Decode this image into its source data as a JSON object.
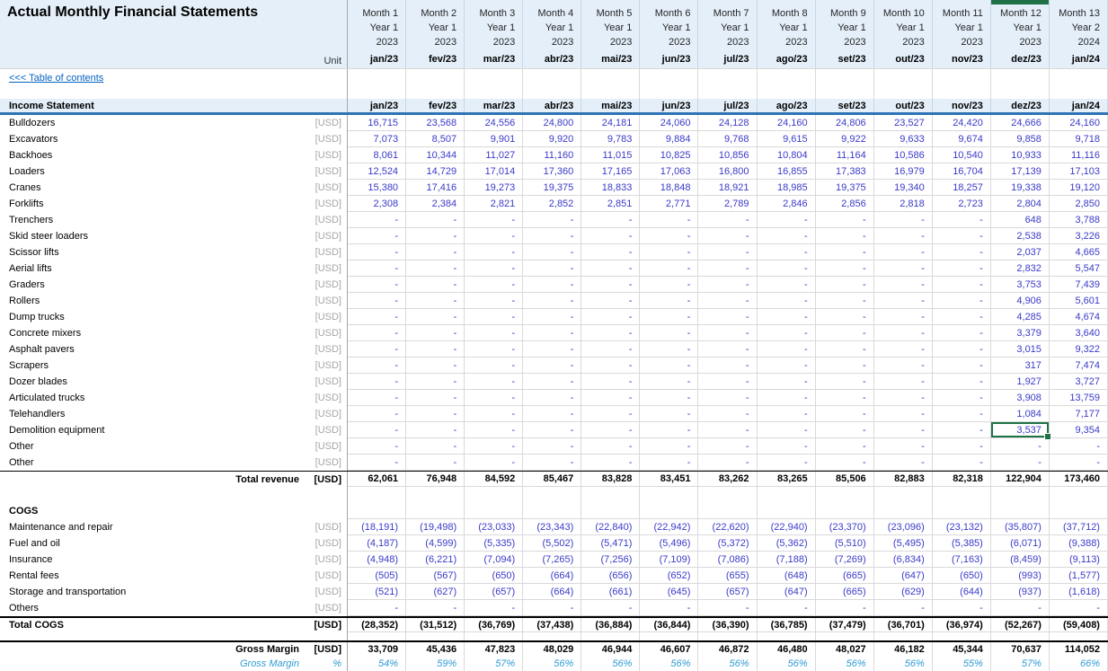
{
  "title": "Actual Monthly Financial Statements",
  "unit_header": "Unit",
  "selected_column_index": 11,
  "colors": {
    "value_blue": "#3A3AC9",
    "pct_blue": "#2E9BD4",
    "band_fill": "#E4EFF9",
    "accent_border": "#2E74B5",
    "selection_green": "#1F7246",
    "link_blue": "#0563C1",
    "unit_gray": "#A6A6A6"
  },
  "columns": [
    {
      "month": "Month 1",
      "year": "Year 1",
      "cal": "2023",
      "date": "jan/23"
    },
    {
      "month": "Month 2",
      "year": "Year 1",
      "cal": "2023",
      "date": "fev/23"
    },
    {
      "month": "Month 3",
      "year": "Year 1",
      "cal": "2023",
      "date": "mar/23"
    },
    {
      "month": "Month 4",
      "year": "Year 1",
      "cal": "2023",
      "date": "abr/23"
    },
    {
      "month": "Month 5",
      "year": "Year 1",
      "cal": "2023",
      "date": "mai/23"
    },
    {
      "month": "Month 6",
      "year": "Year 1",
      "cal": "2023",
      "date": "jun/23"
    },
    {
      "month": "Month 7",
      "year": "Year 1",
      "cal": "2023",
      "date": "jul/23"
    },
    {
      "month": "Month 8",
      "year": "Year 1",
      "cal": "2023",
      "date": "ago/23"
    },
    {
      "month": "Month 9",
      "year": "Year 1",
      "cal": "2023",
      "date": "set/23"
    },
    {
      "month": "Month 10",
      "year": "Year 1",
      "cal": "2023",
      "date": "out/23"
    },
    {
      "month": "Month 11",
      "year": "Year 1",
      "cal": "2023",
      "date": "nov/23"
    },
    {
      "month": "Month 12",
      "year": "Year 1",
      "cal": "2023",
      "date": "dez/23"
    },
    {
      "month": "Month 13",
      "year": "Year 2",
      "cal": "2024",
      "date": "jan/24"
    }
  ],
  "table_rows": [
    {
      "kind": "toc",
      "label": "<<< Table of contents",
      "h": 19
    },
    {
      "kind": "blank",
      "h": 14
    },
    {
      "kind": "band",
      "label": "Income Statement",
      "values": [
        "jan/23",
        "fev/23",
        "mar/23",
        "abr/23",
        "mai/23",
        "jun/23",
        "jul/23",
        "ago/23",
        "set/23",
        "out/23",
        "nov/23",
        "dez/23",
        "jan/24"
      ],
      "h": 18
    },
    {
      "kind": "item",
      "label": "Bulldozers",
      "unit": "[USD]",
      "values": [
        "16,715",
        "23,568",
        "24,556",
        "24,800",
        "24,181",
        "24,060",
        "24,128",
        "24,160",
        "24,806",
        "23,527",
        "24,420",
        "24,666",
        "24,160"
      ]
    },
    {
      "kind": "item",
      "label": "Excavators",
      "unit": "[USD]",
      "values": [
        "7,073",
        "8,507",
        "9,901",
        "9,920",
        "9,783",
        "9,884",
        "9,768",
        "9,615",
        "9,922",
        "9,633",
        "9,674",
        "9,858",
        "9,718"
      ]
    },
    {
      "kind": "item",
      "label": "Backhoes",
      "unit": "[USD]",
      "values": [
        "8,061",
        "10,344",
        "11,027",
        "11,160",
        "11,015",
        "10,825",
        "10,856",
        "10,804",
        "11,164",
        "10,586",
        "10,540",
        "10,933",
        "11,116"
      ]
    },
    {
      "kind": "item",
      "label": "Loaders",
      "unit": "[USD]",
      "values": [
        "12,524",
        "14,729",
        "17,014",
        "17,360",
        "17,165",
        "17,063",
        "16,800",
        "16,855",
        "17,383",
        "16,979",
        "16,704",
        "17,139",
        "17,103"
      ]
    },
    {
      "kind": "item",
      "label": "Cranes",
      "unit": "[USD]",
      "values": [
        "15,380",
        "17,416",
        "19,273",
        "19,375",
        "18,833",
        "18,848",
        "18,921",
        "18,985",
        "19,375",
        "19,340",
        "18,257",
        "19,338",
        "19,120"
      ]
    },
    {
      "kind": "item",
      "label": "Forklifts",
      "unit": "[USD]",
      "values": [
        "2,308",
        "2,384",
        "2,821",
        "2,852",
        "2,851",
        "2,771",
        "2,789",
        "2,846",
        "2,856",
        "2,818",
        "2,723",
        "2,804",
        "2,850"
      ]
    },
    {
      "kind": "item",
      "label": "Trenchers",
      "unit": "[USD]",
      "values": [
        "-",
        "-",
        "-",
        "-",
        "-",
        "-",
        "-",
        "-",
        "-",
        "-",
        "-",
        "648",
        "3,788"
      ]
    },
    {
      "kind": "item",
      "label": "Skid steer loaders",
      "unit": "[USD]",
      "values": [
        "-",
        "-",
        "-",
        "-",
        "-",
        "-",
        "-",
        "-",
        "-",
        "-",
        "-",
        "2,538",
        "3,226"
      ]
    },
    {
      "kind": "item",
      "label": "Scissor lifts",
      "unit": "[USD]",
      "values": [
        "-",
        "-",
        "-",
        "-",
        "-",
        "-",
        "-",
        "-",
        "-",
        "-",
        "-",
        "2,037",
        "4,665"
      ]
    },
    {
      "kind": "item",
      "label": "Aerial lifts",
      "unit": "[USD]",
      "values": [
        "-",
        "-",
        "-",
        "-",
        "-",
        "-",
        "-",
        "-",
        "-",
        "-",
        "-",
        "2,832",
        "5,547"
      ]
    },
    {
      "kind": "item",
      "label": "Graders",
      "unit": "[USD]",
      "values": [
        "-",
        "-",
        "-",
        "-",
        "-",
        "-",
        "-",
        "-",
        "-",
        "-",
        "-",
        "3,753",
        "7,439"
      ]
    },
    {
      "kind": "item",
      "label": "Rollers",
      "unit": "[USD]",
      "values": [
        "-",
        "-",
        "-",
        "-",
        "-",
        "-",
        "-",
        "-",
        "-",
        "-",
        "-",
        "4,906",
        "5,601"
      ]
    },
    {
      "kind": "item",
      "label": "Dump trucks",
      "unit": "[USD]",
      "values": [
        "-",
        "-",
        "-",
        "-",
        "-",
        "-",
        "-",
        "-",
        "-",
        "-",
        "-",
        "4,285",
        "4,674"
      ]
    },
    {
      "kind": "item",
      "label": "Concrete mixers",
      "unit": "[USD]",
      "values": [
        "-",
        "-",
        "-",
        "-",
        "-",
        "-",
        "-",
        "-",
        "-",
        "-",
        "-",
        "3,379",
        "3,640"
      ]
    },
    {
      "kind": "item",
      "label": "Asphalt pavers",
      "unit": "[USD]",
      "values": [
        "-",
        "-",
        "-",
        "-",
        "-",
        "-",
        "-",
        "-",
        "-",
        "-",
        "-",
        "3,015",
        "9,322"
      ]
    },
    {
      "kind": "item",
      "label": "Scrapers",
      "unit": "[USD]",
      "values": [
        "-",
        "-",
        "-",
        "-",
        "-",
        "-",
        "-",
        "-",
        "-",
        "-",
        "-",
        "317",
        "7,474"
      ]
    },
    {
      "kind": "item",
      "label": "Dozer blades",
      "unit": "[USD]",
      "values": [
        "-",
        "-",
        "-",
        "-",
        "-",
        "-",
        "-",
        "-",
        "-",
        "-",
        "-",
        "1,927",
        "3,727"
      ]
    },
    {
      "kind": "item",
      "label": "Articulated trucks",
      "unit": "[USD]",
      "values": [
        "-",
        "-",
        "-",
        "-",
        "-",
        "-",
        "-",
        "-",
        "-",
        "-",
        "-",
        "3,908",
        "13,759"
      ]
    },
    {
      "kind": "item",
      "label": "Telehandlers",
      "unit": "[USD]",
      "values": [
        "-",
        "-",
        "-",
        "-",
        "-",
        "-",
        "-",
        "-",
        "-",
        "-",
        "-",
        "1,084",
        "7,177"
      ]
    },
    {
      "kind": "item",
      "label": "Demolition equipment",
      "unit": "[USD]",
      "sel": 11,
      "values": [
        "-",
        "-",
        "-",
        "-",
        "-",
        "-",
        "-",
        "-",
        "-",
        "-",
        "-",
        "3,537",
        "9,354"
      ]
    },
    {
      "kind": "item",
      "label": "Other",
      "unit": "[USD]",
      "values": [
        "-",
        "-",
        "-",
        "-",
        "-",
        "-",
        "-",
        "-",
        "-",
        "-",
        "-",
        "-",
        "-"
      ]
    },
    {
      "kind": "item",
      "label": "Other",
      "unit": "[USD]",
      "values": [
        "-",
        "-",
        "-",
        "-",
        "-",
        "-",
        "-",
        "-",
        "-",
        "-",
        "-",
        "-",
        "-"
      ]
    },
    {
      "kind": "total-right",
      "label": "Total revenue",
      "unit": "[USD]",
      "values": [
        "62,061",
        "76,948",
        "84,592",
        "85,467",
        "83,828",
        "83,451",
        "83,262",
        "83,265",
        "85,506",
        "82,883",
        "82,318",
        "122,904",
        "173,460"
      ]
    },
    {
      "kind": "blank",
      "h": 18
    },
    {
      "kind": "section",
      "label": "COGS",
      "h": 18
    },
    {
      "kind": "item",
      "label": "Maintenance and repair",
      "unit": "[USD]",
      "values": [
        "(18,191)",
        "(19,498)",
        "(23,033)",
        "(23,343)",
        "(22,840)",
        "(22,942)",
        "(22,620)",
        "(22,940)",
        "(23,370)",
        "(23,096)",
        "(23,132)",
        "(35,807)",
        "(37,712)"
      ]
    },
    {
      "kind": "item",
      "label": "Fuel and oil",
      "unit": "[USD]",
      "values": [
        "(4,187)",
        "(4,599)",
        "(5,335)",
        "(5,502)",
        "(5,471)",
        "(5,496)",
        "(5,372)",
        "(5,362)",
        "(5,510)",
        "(5,495)",
        "(5,385)",
        "(6,071)",
        "(9,388)"
      ]
    },
    {
      "kind": "item",
      "label": "Insurance",
      "unit": "[USD]",
      "values": [
        "(4,948)",
        "(6,221)",
        "(7,094)",
        "(7,265)",
        "(7,256)",
        "(7,109)",
        "(7,086)",
        "(7,188)",
        "(7,269)",
        "(6,834)",
        "(7,163)",
        "(8,459)",
        "(9,113)"
      ]
    },
    {
      "kind": "item",
      "label": "Rental fees",
      "unit": "[USD]",
      "values": [
        "(505)",
        "(567)",
        "(650)",
        "(664)",
        "(656)",
        "(652)",
        "(655)",
        "(648)",
        "(665)",
        "(647)",
        "(650)",
        "(993)",
        "(1,577)"
      ]
    },
    {
      "kind": "item",
      "label": "Storage and transportation",
      "unit": "[USD]",
      "values": [
        "(521)",
        "(627)",
        "(657)",
        "(664)",
        "(661)",
        "(645)",
        "(657)",
        "(647)",
        "(665)",
        "(629)",
        "(644)",
        "(937)",
        "(1,618)"
      ]
    },
    {
      "kind": "item",
      "label": "Others",
      "unit": "[USD]",
      "values": [
        "-",
        "-",
        "-",
        "-",
        "-",
        "-",
        "-",
        "-",
        "-",
        "-",
        "-",
        "-",
        "-"
      ]
    },
    {
      "kind": "total-left",
      "label": "Total COGS",
      "unit": "[USD]",
      "values": [
        "(28,352)",
        "(31,512)",
        "(36,769)",
        "(37,438)",
        "(36,884)",
        "(36,844)",
        "(36,390)",
        "(36,785)",
        "(37,479)",
        "(36,701)",
        "(36,974)",
        "(52,267)",
        "(59,408)"
      ]
    },
    {
      "kind": "blank",
      "h": 9
    },
    {
      "kind": "gm",
      "label": "Gross Margin",
      "unit": "[USD]",
      "values": [
        "33,709",
        "45,436",
        "47,823",
        "48,029",
        "46,944",
        "46,607",
        "46,872",
        "46,480",
        "48,027",
        "46,182",
        "45,344",
        "70,637",
        "114,052"
      ]
    },
    {
      "kind": "gmpct",
      "label": "Gross Margin",
      "unit": "%",
      "h": 16,
      "values": [
        "54%",
        "59%",
        "57%",
        "56%",
        "56%",
        "56%",
        "56%",
        "56%",
        "56%",
        "56%",
        "55%",
        "57%",
        "66%"
      ]
    }
  ]
}
